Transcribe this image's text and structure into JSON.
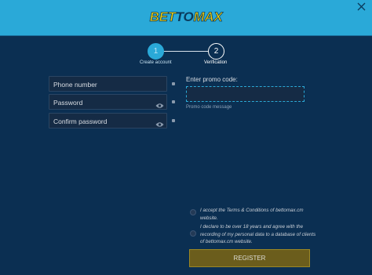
{
  "header": {
    "logo": {
      "part1": "BET",
      "part2": "TO",
      "part3": "MAX"
    },
    "close_icon": "close-icon",
    "background_color": "#2aa9d8"
  },
  "steps": [
    {
      "number": "1",
      "label": "Create account",
      "active": true
    },
    {
      "number": "2",
      "label": "Verification",
      "active": false
    }
  ],
  "form": {
    "phone": {
      "placeholder": "Phone number",
      "value": ""
    },
    "password": {
      "placeholder": "Password",
      "value": "",
      "icon": "eye-icon"
    },
    "confirm_password": {
      "placeholder": "Confirm password",
      "value": "",
      "icon": "eye-icon"
    },
    "promo": {
      "label": "Enter promo code:",
      "placeholder": "",
      "value": "",
      "message": "Promo code message"
    },
    "terms_text": "I accept the Terms & Conditions of bettomax.cm website.",
    "age_text": "I declare to be over 18 years and agree with the recording of my personal data to a database of clients of bettomax.cm website.",
    "register_label": "REGISTER"
  },
  "colors": {
    "background": "#0b2f52",
    "accent": "#2aa9d8",
    "brand_yellow": "#f3cf0b",
    "button": "#6b5d1c"
  }
}
